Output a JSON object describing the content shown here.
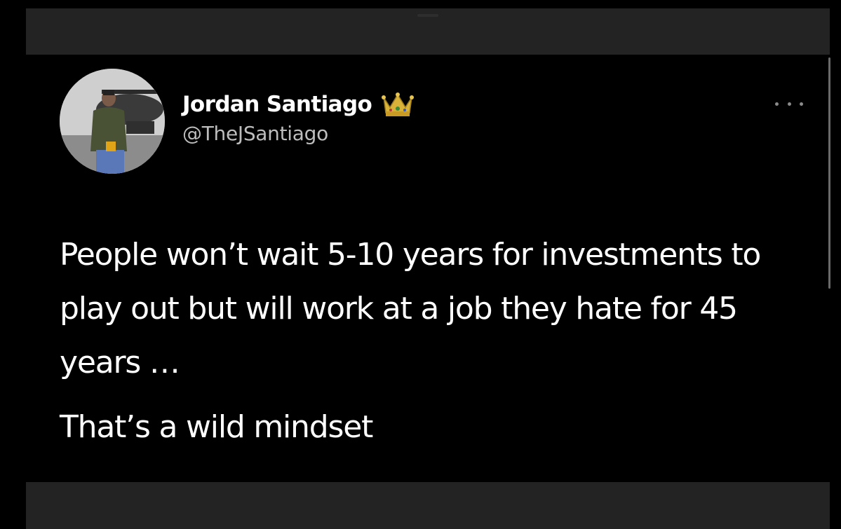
{
  "tweet": {
    "author": {
      "display_name": "Jordan Santiago",
      "handle": "@TheJSantiago",
      "badge_icon": "crown-icon",
      "avatar_icon": "profile-photo"
    },
    "more_icon": "more-dots-icon",
    "text_lines": [
      "People won’t wait 5-10 years for investments to play out but will work at a job they hate for 45 years …",
      "That’s a wild mindset"
    ]
  },
  "colors": {
    "background": "#000000",
    "bars": "#232323",
    "text": "#ffffff",
    "secondary_text": "#bdbdbd",
    "crown": "#d9b23a"
  }
}
